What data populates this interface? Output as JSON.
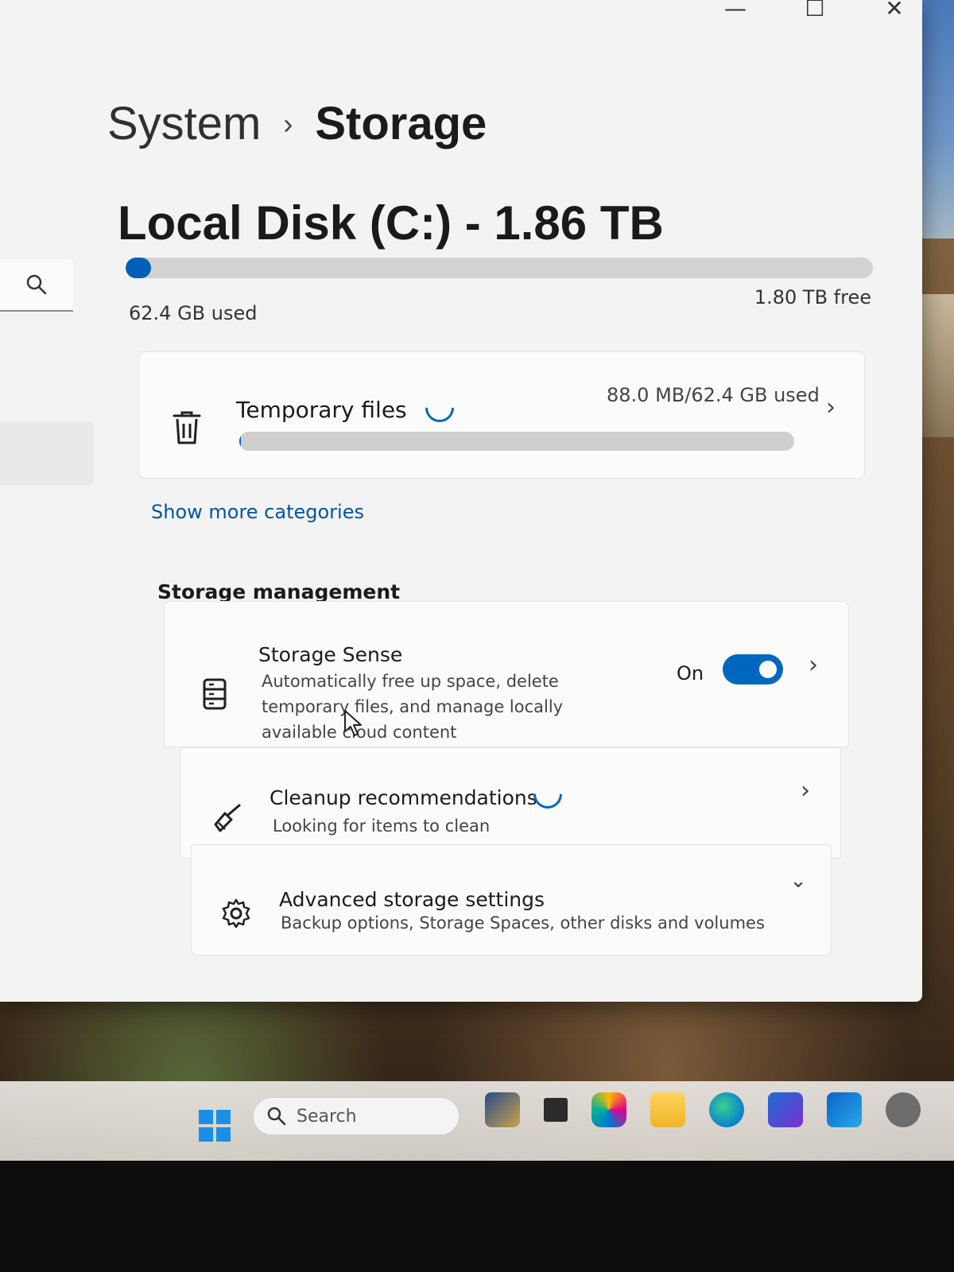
{
  "window": {
    "caption": {
      "minimize": "—",
      "maximize": "☐",
      "close": "✕"
    }
  },
  "breadcrumb": {
    "parent": "System",
    "separator": "›",
    "current": "Storage"
  },
  "disk": {
    "title": "Local Disk (C:) - 1.86 TB",
    "used_label": "62.4 GB used",
    "free_label": "1.80 TB free",
    "used_fraction": 0.033
  },
  "temp_files": {
    "title": "Temporary files",
    "usage": "88.0 MB/62.4 GB used",
    "used_fraction": 0.0014
  },
  "show_more": "Show more categories",
  "storage_management": {
    "heading": "Storage management",
    "storage_sense": {
      "title": "Storage Sense",
      "description": "Automatically free up space, delete temporary files, and manage locally available cloud content",
      "state": "On"
    },
    "cleanup": {
      "title": "Cleanup recommendations",
      "description": "Looking for items to clean"
    },
    "advanced": {
      "title": "Advanced storage settings",
      "description": "Backup options, Storage Spaces, other disks and volumes"
    }
  },
  "taskbar": {
    "search_placeholder": "Search"
  },
  "colors": {
    "accent": "#005fb8",
    "link": "#00549e",
    "background": "#f3f3f3",
    "card": "#fbfbfb"
  },
  "icons": [
    "search-icon",
    "trash-icon",
    "storage-sense-icon",
    "broom-icon",
    "gear-icon",
    "chevron-right-icon",
    "chevron-down-icon",
    "windows-start-icon"
  ]
}
